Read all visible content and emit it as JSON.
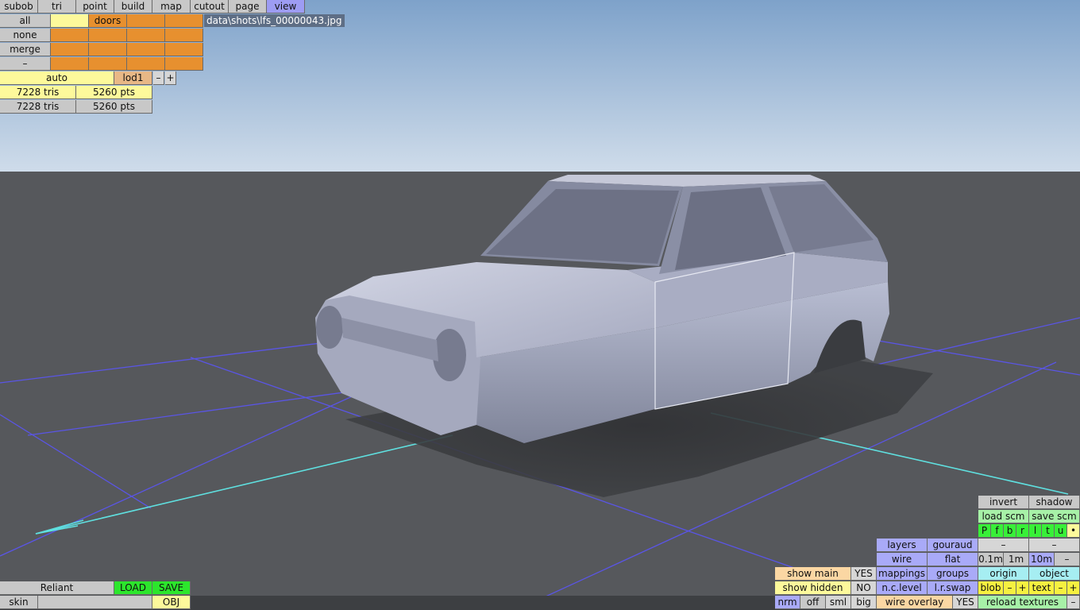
{
  "menu": {
    "tabs": [
      "subob",
      "tri",
      "point",
      "build",
      "map",
      "cutout",
      "page",
      "view"
    ],
    "active": "view"
  },
  "filepath": "data\\shots\\lfs_00000043.jpg",
  "subobject_panel": {
    "row_labels": [
      "all",
      "none",
      "merge",
      "–"
    ],
    "first_group_label": "doors",
    "lod_label": "auto",
    "lod_value": "lod1",
    "lod_minus": "–",
    "lod_plus": "+",
    "stats": [
      {
        "tris": "7228 tris",
        "pts": "5260 pts"
      },
      {
        "tris": "7228 tris",
        "pts": "5260 pts"
      }
    ]
  },
  "car_panel": {
    "name": "Reliant",
    "load_label": "LOAD",
    "save_label": "SAVE",
    "skin_label": "skin",
    "skin_value": "",
    "obj_label": "OBJ"
  },
  "view_panel": {
    "invert": "invert",
    "shadow": "shadow",
    "load_scm": "load scm",
    "save_scm": "save scm",
    "filters": [
      "P",
      "f",
      "b",
      "r",
      "l",
      "t",
      "u",
      "•"
    ],
    "layers": "layers",
    "gouraud": "gouraud",
    "dash1": "–",
    "dash2": "–",
    "wire": "wire",
    "flat": "flat",
    "scale_01": "0.1m",
    "scale_1": "1m",
    "scale_10": "10m",
    "scale_minus": "–",
    "show_main": "show main",
    "show_main_value": "YES",
    "mappings": "mappings",
    "groups": "groups",
    "origin": "origin",
    "object": "object",
    "show_hidden": "show hidden",
    "show_hidden_value": "NO",
    "nc_level": "n.c.level",
    "lr_swap": "l.r.swap",
    "blob": "blob",
    "blob_minus": "–",
    "blob_plus": "+",
    "text": "text",
    "text_minus": "–",
    "text_plus": "+",
    "nrm": "nrm",
    "off": "off",
    "sml": "sml",
    "big": "big",
    "wire_overlay": "wire overlay",
    "wire_overlay_value": "YES",
    "reload_textures": "reload textures",
    "reload_minus": "–"
  },
  "colors": {
    "sky_top": "#7ea2ca",
    "sky_bottom": "#cddbea",
    "ground": "#56585c",
    "grid_line": "#5a55e6",
    "axis_line": "#5fe0e0",
    "car_body": "#9da2b9"
  }
}
